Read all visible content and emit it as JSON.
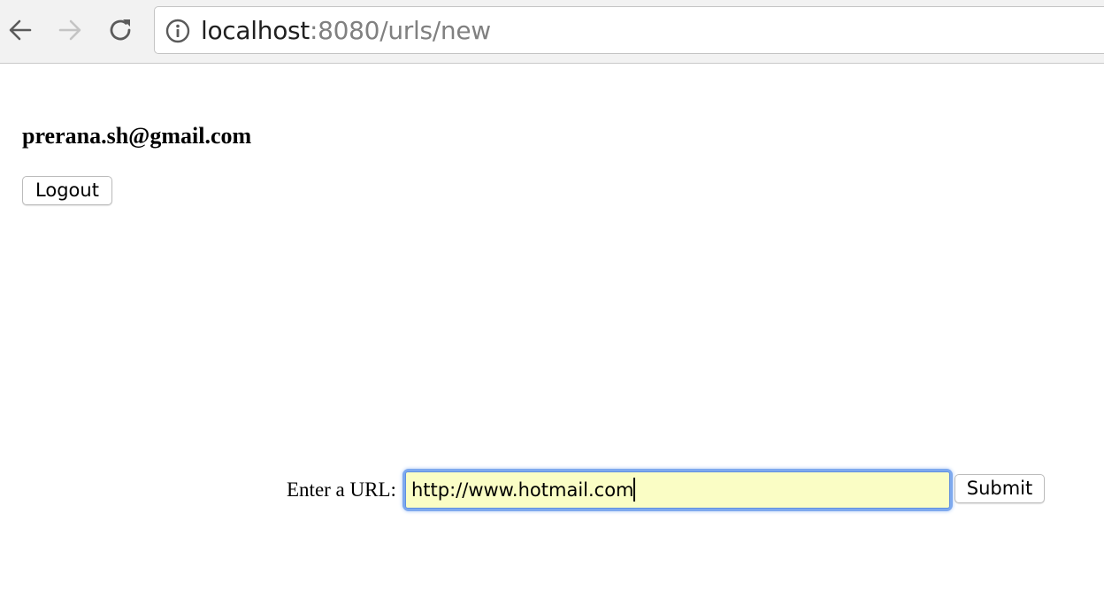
{
  "browser": {
    "nav": {
      "back_icon": "arrow-left-icon",
      "forward_icon": "arrow-right-icon",
      "forward_enabled": false,
      "reload_icon": "reload-icon"
    },
    "address_bar": {
      "security_icon": "info-icon",
      "host": "localhost",
      "rest": ":8080/urls/new"
    }
  },
  "page": {
    "user_email": "prerana.sh@gmail.com",
    "logout_label": "Logout",
    "url_form": {
      "label": "Enter a URL:",
      "input_value": "http://www.hotmail.com",
      "submit_label": "Submit"
    }
  },
  "colors": {
    "toolbar_bg": "#f2f2f2",
    "input_autofill_bg": "#fafdc5",
    "focus_ring": "#7ea9ee"
  }
}
